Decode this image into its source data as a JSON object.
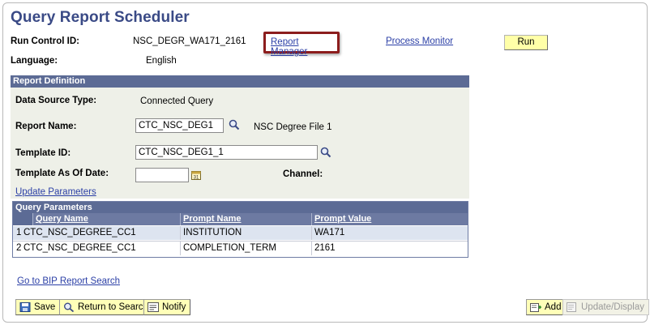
{
  "page": {
    "title": "Query Report Scheduler"
  },
  "header": {
    "run_control_label": "Run Control ID:",
    "run_control_value": "NSC_DEGR_WA171_2161",
    "report_manager_link": "Report Manager",
    "process_monitor_link": "Process Monitor",
    "run_button": "Run",
    "language_label": "Language:",
    "language_value": "English"
  },
  "report_definition": {
    "section_title": "Report Definition",
    "data_source_label": "Data Source Type:",
    "data_source_value": "Connected Query",
    "report_name_label": "Report Name:",
    "report_name_value": "CTC_NSC_DEG1",
    "report_name_desc": "NSC Degree File 1",
    "template_id_label": "Template ID:",
    "template_id_value": "CTC_NSC_DEG1_1",
    "template_date_label": "Template As Of Date:",
    "template_date_value": "",
    "channel_label": "Channel:",
    "update_parameters_link": "Update Parameters"
  },
  "query_parameters": {
    "title": "Query Parameters",
    "columns": [
      "Query Name",
      "Prompt Name",
      "Prompt Value"
    ],
    "rows": [
      {
        "num": "1",
        "query": "CTC_NSC_DEGREE_CC1",
        "prompt": "INSTITUTION",
        "value": "WA171"
      },
      {
        "num": "2",
        "query": "CTC_NSC_DEGREE_CC1",
        "prompt": "COMPLETION_TERM",
        "value": "2161"
      }
    ]
  },
  "footer": {
    "bip_link": "Go to BIP Report Search",
    "save_button": "Save",
    "return_button": "Return to Search",
    "notify_button": "Notify",
    "add_button": "Add",
    "update_display_button": "Update/Display"
  },
  "colors": {
    "title": "#3a4a86",
    "section_header": "#5c6b95",
    "section_bg": "#eef0e8",
    "highlight_border": "#8c1d1d",
    "button_bg": "#ffffb8"
  }
}
